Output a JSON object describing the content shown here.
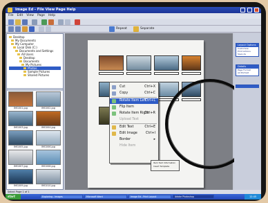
{
  "window": {
    "title": "Image Ed - File View Page Help",
    "menu": [
      "File",
      "Edit",
      "View",
      "Page",
      "Help"
    ]
  },
  "toolbar": {
    "repeat_label": "Repeat",
    "separate_label": "Separate"
  },
  "tree": {
    "items": [
      "Desktop",
      "My Documents",
      "My Computer",
      "Local Disk (C:)",
      "Documents and Settings",
      "All Users",
      "Desktop",
      "Documents",
      "My Pictures",
      "Photos",
      "Sample Pictures",
      "Shared Pictures"
    ]
  },
  "thumbs": {
    "captions": [
      "IMG001.jpg",
      "IMG002.jpg",
      "IMG003.jpg",
      "IMG004.jpg",
      "IMG005.jpg",
      "IMG006.jpg",
      "IMG007.jpg",
      "IMG008.jpg",
      "IMG009.jpg",
      "IMG010.jpg"
    ]
  },
  "context_menu": {
    "items": [
      {
        "label": "Cut",
        "shortcut": "Ctrl+X"
      },
      {
        "label": "Copy",
        "shortcut": "Ctrl+C"
      },
      {
        "label": "Rotate Item Left",
        "shortcut": "Ctrl+L"
      },
      {
        "label": "Flip Item",
        "shortcut": ""
      },
      {
        "label": "Rotate Item Right",
        "shortcut": "Ctrl+R"
      },
      {
        "label": "Upload Text",
        "shortcut": ""
      },
      {
        "label": "Edit Text",
        "shortcut": "Ctrl+E"
      },
      {
        "label": "Edit Image",
        "shortcut": "Ctrl+I"
      },
      {
        "label": "Border",
        "shortcut": ""
      },
      {
        "label": "Hide Item",
        "shortcut": ""
      }
    ],
    "submenu": [
      "Item Text Information",
      "Insert Template"
    ]
  },
  "right_panel": {
    "boxes": [
      {
        "title": "Layout Options",
        "lines": [
          "Customize",
          "Print Actions",
          "Save As"
        ]
      },
      {
        "title": "Details",
        "lines": [
          "Page Format",
          "A4 Portrait"
        ]
      }
    ]
  },
  "statusbar": {
    "text": "Select Page 1 of 1"
  },
  "taskbar": {
    "start": "start",
    "tasks": [
      "Exploring - Images",
      "Microsoft Word",
      "Image Ed - Print Layout",
      "Adobe Photoshop"
    ],
    "clock": "12:45"
  },
  "colors": {
    "title_bar": "#1b3497",
    "highlight": "#2f5cc6",
    "page_bg": "#f4f4f2",
    "canvas_bg": "#7d7f85"
  }
}
